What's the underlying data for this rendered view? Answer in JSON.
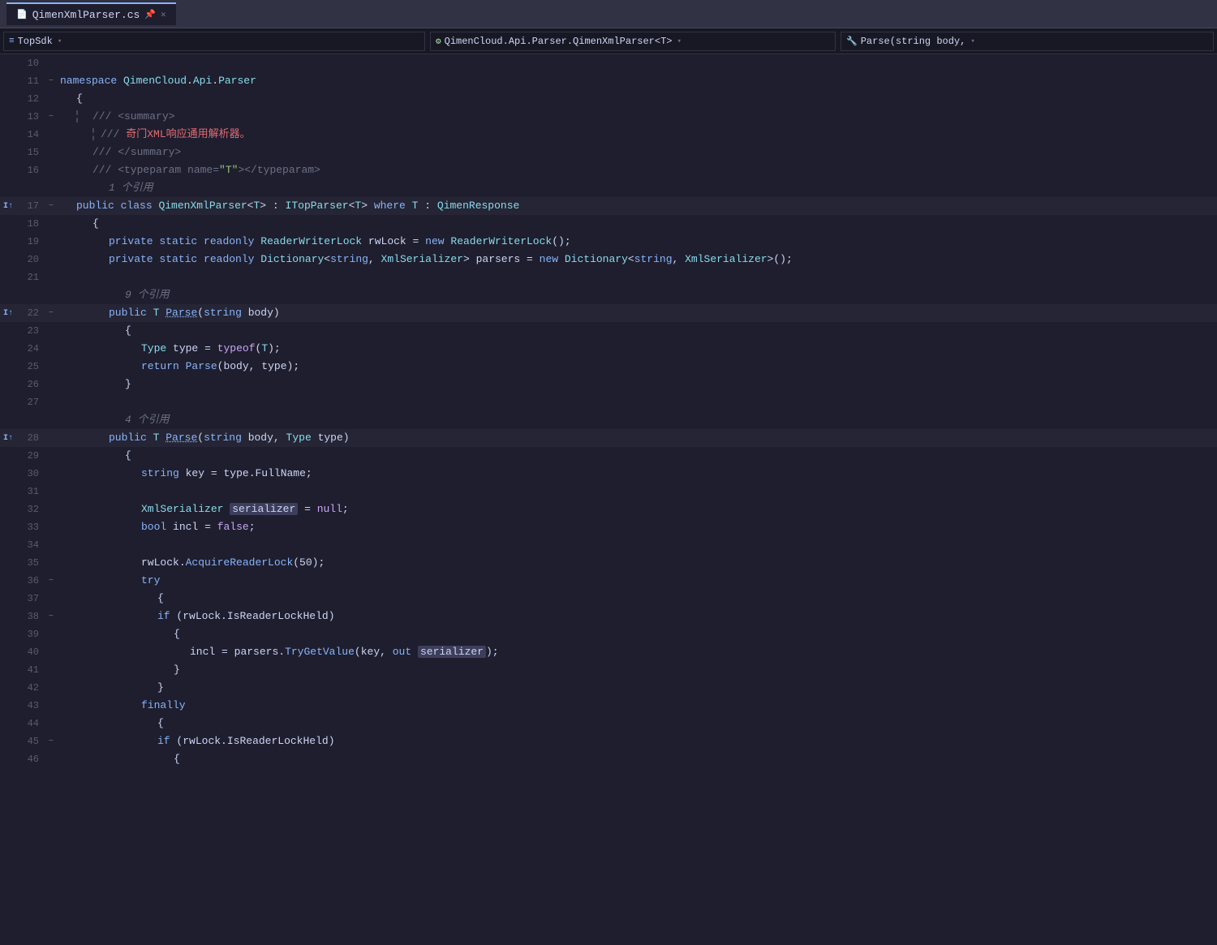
{
  "titleBar": {
    "tab": {
      "label": "QimenXmlParser.cs",
      "icon": "📄",
      "pinIcon": "📌"
    }
  },
  "toolbar": {
    "breadcrumb1": {
      "icon": "≡",
      "text": "TopSdk"
    },
    "breadcrumb2": {
      "icon": "⚙",
      "text": "QimenCloud.Api.Parser.QimenXmlParser<T>"
    },
    "breadcrumb3": {
      "icon": "🔧",
      "text": "Parse(string body,"
    }
  },
  "lines": [
    {
      "num": 10,
      "indent": 0,
      "fold": false,
      "indicator": "",
      "content": ""
    },
    {
      "num": 11,
      "indent": 0,
      "fold": true,
      "foldOpen": true,
      "indicator": "",
      "content": "namespace_line"
    },
    {
      "num": 12,
      "indent": 1,
      "fold": false,
      "indicator": "",
      "content": "open_brace_1"
    },
    {
      "num": 13,
      "indent": 1,
      "fold": true,
      "foldOpen": true,
      "indicator": "",
      "content": "doc_summary_open"
    },
    {
      "num": 14,
      "indent": 1,
      "fold": false,
      "indicator": "",
      "content": "doc_desc"
    },
    {
      "num": 15,
      "indent": 1,
      "fold": false,
      "indicator": "",
      "content": "doc_summary_close"
    },
    {
      "num": 16,
      "indent": 1,
      "fold": false,
      "indicator": "",
      "content": "doc_typeparam"
    },
    {
      "num": "",
      "indent": 1,
      "fold": false,
      "indicator": "",
      "content": "ref_1"
    },
    {
      "num": 17,
      "indent": 1,
      "fold": true,
      "foldOpen": true,
      "indicator": "I↑",
      "content": "class_decl"
    },
    {
      "num": 18,
      "indent": 2,
      "fold": false,
      "indicator": "",
      "content": "open_brace_2"
    },
    {
      "num": 19,
      "indent": 2,
      "fold": false,
      "indicator": "",
      "content": "field_rwlock"
    },
    {
      "num": 20,
      "indent": 2,
      "fold": false,
      "indicator": "",
      "content": "field_parsers"
    },
    {
      "num": 21,
      "indent": 2,
      "fold": false,
      "indicator": "",
      "content": "empty"
    },
    {
      "num": "",
      "indent": 2,
      "fold": false,
      "indicator": "",
      "content": "ref_9"
    },
    {
      "num": 22,
      "indent": 2,
      "fold": true,
      "foldOpen": true,
      "indicator": "I↑",
      "content": "method_parse1"
    },
    {
      "num": 23,
      "indent": 3,
      "fold": false,
      "indicator": "",
      "content": "open_brace_3"
    },
    {
      "num": 24,
      "indent": 3,
      "fold": false,
      "indicator": "",
      "content": "type_type"
    },
    {
      "num": 25,
      "indent": 3,
      "fold": false,
      "indicator": "",
      "content": "return_parse"
    },
    {
      "num": 26,
      "indent": 3,
      "fold": false,
      "indicator": "",
      "content": "close_brace_3"
    },
    {
      "num": 27,
      "indent": 2,
      "fold": false,
      "indicator": "",
      "content": "empty"
    },
    {
      "num": "",
      "indent": 2,
      "fold": false,
      "indicator": "",
      "content": "ref_4"
    },
    {
      "num": 28,
      "indent": 2,
      "fold": false,
      "indicator": "I↑",
      "content": "method_parse2"
    },
    {
      "num": 29,
      "indent": 3,
      "fold": false,
      "indicator": "",
      "content": "open_brace_4"
    },
    {
      "num": 30,
      "indent": 3,
      "fold": false,
      "indicator": "",
      "content": "string_key"
    },
    {
      "num": 31,
      "indent": 3,
      "fold": false,
      "indicator": "",
      "content": "empty"
    },
    {
      "num": 32,
      "indent": 3,
      "fold": false,
      "indicator": "",
      "content": "xmlser_decl"
    },
    {
      "num": 33,
      "indent": 3,
      "fold": false,
      "indicator": "",
      "content": "bool_incl"
    },
    {
      "num": 34,
      "indent": 3,
      "fold": false,
      "indicator": "",
      "content": "empty"
    },
    {
      "num": 35,
      "indent": 3,
      "fold": false,
      "indicator": "",
      "content": "rwlock_acquire"
    },
    {
      "num": 36,
      "indent": 3,
      "fold": true,
      "foldOpen": true,
      "indicator": "",
      "content": "try_stmt"
    },
    {
      "num": 37,
      "indent": 4,
      "fold": false,
      "indicator": "",
      "content": "open_brace_5"
    },
    {
      "num": 38,
      "indent": 4,
      "fold": true,
      "foldOpen": true,
      "indicator": "",
      "content": "if_stmt"
    },
    {
      "num": 39,
      "indent": 5,
      "fold": false,
      "indicator": "",
      "content": "open_brace_6"
    },
    {
      "num": 40,
      "indent": 5,
      "fold": false,
      "indicator": "",
      "content": "incl_assign"
    },
    {
      "num": 41,
      "indent": 5,
      "fold": false,
      "indicator": "",
      "content": "close_brace_6"
    },
    {
      "num": 42,
      "indent": 4,
      "fold": false,
      "indicator": "",
      "content": "close_brace_5"
    },
    {
      "num": 43,
      "indent": 3,
      "fold": false,
      "indicator": "",
      "content": "finally_stmt"
    },
    {
      "num": 44,
      "indent": 4,
      "fold": false,
      "indicator": "",
      "content": "open_brace_7"
    },
    {
      "num": 45,
      "indent": 4,
      "fold": true,
      "foldOpen": true,
      "indicator": "",
      "content": "if_rwlock2"
    },
    {
      "num": 46,
      "indent": 5,
      "fold": false,
      "indicator": "",
      "content": "open_brace_8"
    }
  ]
}
